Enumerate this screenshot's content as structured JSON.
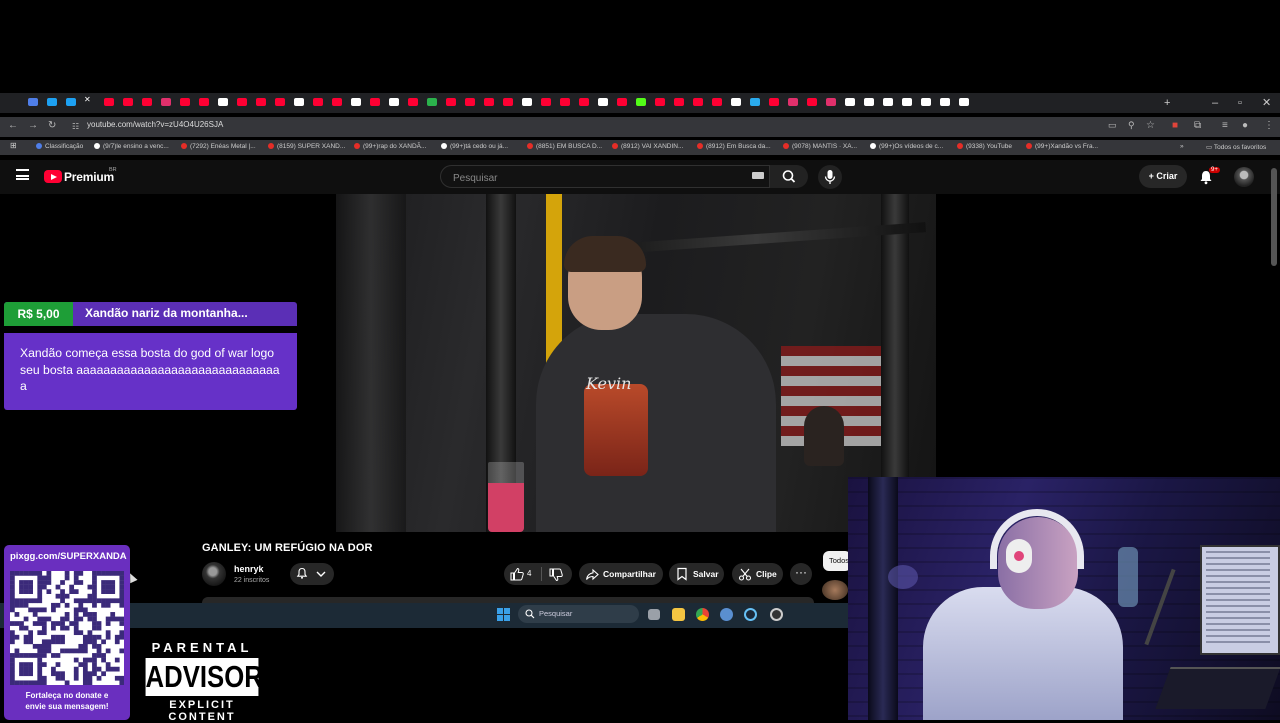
{
  "browser": {
    "url": "youtube.com/watch?v=zU4O4U26SJA",
    "bookmarks": [
      "Classificação",
      "(9/7)le ensino a venc...",
      "(7292) Enéas Metal |...",
      "(8159) SUPER XAND...",
      "(99+)rap do XANDÃ...",
      "(99+)tá cedo ou já...",
      "(8851) EM BUSCA D...",
      "(8912) VAI XANDIN...",
      "(8912) Em Busca da...",
      "(9078) MANTIS · XA...",
      "(99+)Os vídeos de c...",
      "(9338) YouTube",
      "(99+)Xandão vs Fra..."
    ],
    "all_bookmarks_label": "Todos os favoritos"
  },
  "youtube": {
    "brand": "Premium",
    "region": "BR",
    "search_placeholder": "Pesquisar",
    "create_label": "Criar",
    "notification_count": "9+",
    "video_title": "GANLEY: UM REFÚGIO NA DOR",
    "channel_name": "henryk",
    "subscribers": "22 inscritos",
    "like_count": "4",
    "share_label": "Compartilhar",
    "save_label": "Salvar",
    "clip_label": "Clipe",
    "chip_all_label": "Todos",
    "shirt_text": "Kevin"
  },
  "taskbar": {
    "search_label": "Pesquisar"
  },
  "superchat": {
    "amount": "R$ 5,00",
    "name": "Xandão nariz da montanha...",
    "message": "Xandão começa essa bosta do god of war logo seu bosta aaaaaaaaaaaaaaaaaaaaaaaaaaaaaaa"
  },
  "donate_card": {
    "url": "pixgg.com/SUPERXANDA",
    "caption_line1": "Fortaleça no donate e",
    "caption_line2": "envie sua mensagem!"
  },
  "parental_advisory": {
    "top": "PARENTAL",
    "middle": "ADVISORY",
    "bottom": "EXPLICIT CONTENT"
  },
  "colors": {
    "superchat_purple": "#6631c8",
    "superchat_green": "#1e9e37",
    "youtube_red": "#ff0033"
  }
}
